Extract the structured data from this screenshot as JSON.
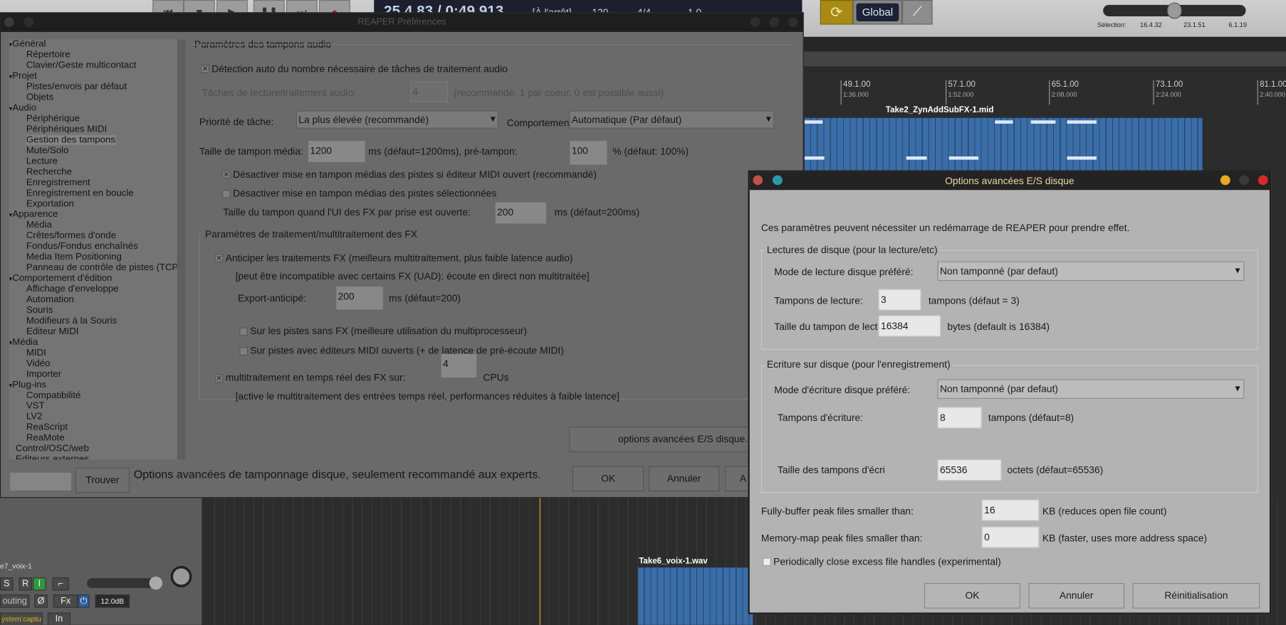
{
  "transport": {
    "buttons": [
      "⏮",
      "■",
      "▶",
      "❚❚",
      "⏭",
      "●"
    ],
    "time": "25.4.83 / 0:49.913",
    "state": "[À l'arrêt]",
    "bpm": "120",
    "sig": "4/4",
    "rate": "1.0"
  },
  "toolbar": {
    "global_label": "Global",
    "selection_label": "Sélection:",
    "sel_start": "16.4.32",
    "sel_end": "23.1.51",
    "sel_len": "6.1.19"
  },
  "ruler": [
    {
      "bar": "49.1.00",
      "time": "1:36.000"
    },
    {
      "bar": "57.1.00",
      "time": "1:52.000"
    },
    {
      "bar": "65.1.00",
      "time": "2:08.000"
    },
    {
      "bar": "73.1.00",
      "time": "2:24.000"
    },
    {
      "bar": "81.1.00",
      "time": "2:40.000"
    }
  ],
  "items": {
    "midi": "Take2_ZynAddSubFX-1.mid",
    "audio": "Take6_voix-1.wav"
  },
  "track": {
    "name": "e7_voix-1",
    "solo": "S",
    "rec": "R",
    "input": "I",
    "routing": "outing",
    "phase": "Ø",
    "fx": "Fx",
    "gain": "12.0dB",
    "input_src": "ystem:captu",
    "in": "In"
  },
  "prefs": {
    "title": "REAPER Préférences",
    "tree": [
      {
        "l": "Général",
        "lvl": 0
      },
      {
        "l": "Répertoire",
        "lvl": 1
      },
      {
        "l": "Clavier/Geste multicontact",
        "lvl": 1
      },
      {
        "l": "Projet",
        "lvl": 0
      },
      {
        "l": "Pistes/envois par défaut",
        "lvl": 1
      },
      {
        "l": "Objets",
        "lvl": 1
      },
      {
        "l": "Audio",
        "lvl": 0
      },
      {
        "l": "Périphérique",
        "lvl": 1
      },
      {
        "l": "Périphériques MIDI",
        "lvl": 1
      },
      {
        "l": "Gestion des tampons",
        "lvl": 1,
        "selected": true
      },
      {
        "l": "Mute/Solo",
        "lvl": 1
      },
      {
        "l": "Lecture",
        "lvl": 1
      },
      {
        "l": "Recherche",
        "lvl": 1
      },
      {
        "l": "Enregistrement",
        "lvl": 1
      },
      {
        "l": "Enregistrement en boucle",
        "lvl": 1
      },
      {
        "l": "Exportation",
        "lvl": 1
      },
      {
        "l": "Apparence",
        "lvl": 0
      },
      {
        "l": "Média",
        "lvl": 1
      },
      {
        "l": "Crêtes/formes d'onde",
        "lvl": 1
      },
      {
        "l": "Fondus/Fondus enchaînés",
        "lvl": 1
      },
      {
        "l": "Media Item Positioning",
        "lvl": 1
      },
      {
        "l": "Panneau de contrôle de pistes (TCP)",
        "lvl": 1
      },
      {
        "l": "Comportement d'édition",
        "lvl": 0
      },
      {
        "l": "Affichage d'enveloppe",
        "lvl": 1
      },
      {
        "l": "Automation",
        "lvl": 1
      },
      {
        "l": "Souris",
        "lvl": 1
      },
      {
        "l": "Modifieurs à la Souris",
        "lvl": 1
      },
      {
        "l": "Editeur MIDI",
        "lvl": 1
      },
      {
        "l": "Média",
        "lvl": 0
      },
      {
        "l": "MIDI",
        "lvl": 1
      },
      {
        "l": "Vidéo",
        "lvl": 1
      },
      {
        "l": "Importer",
        "lvl": 1
      },
      {
        "l": "Plug-ins",
        "lvl": 0
      },
      {
        "l": "Compatibilité",
        "lvl": 1
      },
      {
        "l": "VST",
        "lvl": 1
      },
      {
        "l": "LV2",
        "lvl": 1
      },
      {
        "l": "ReaScript",
        "lvl": 1
      },
      {
        "l": "ReaMote",
        "lvl": 1
      },
      {
        "l": "Control/OSC/web",
        "lvl": 0,
        "leaf": true
      },
      {
        "l": "Editeurs externes",
        "lvl": 0,
        "leaf": true
      }
    ],
    "section": "Paramètres des tampons audio",
    "auto_detect": "Détection auto du nombre nécessaire de tâches de traitement audio",
    "tasks_label": "Tâches de lecture/traitement audio:",
    "tasks_value": "4",
    "tasks_hint": "(recommandé: 1 par coeur, 0 est possible aussi)",
    "priority_label": "Priorité de tâche:",
    "priority_value": "La plus élevée (recommandé)",
    "behavior_label": "Comportemen",
    "behavior_value": "Automatique (Par défaut)",
    "media_buf_label": "Taille de tampon média:",
    "media_buf_value": "1200",
    "media_buf_hint": "ms (défaut=1200ms), pré-tampon:",
    "prebuf_value": "100",
    "prebuf_hint": "% (défaut: 100%)",
    "disable_midi": "Désactiver mise en tampon médias des pistes si éditeur MIDI ouvert (recommandé)",
    "disable_sel": "Désactiver mise en tampon médias des pistes sélectionnées",
    "fxui_label": "Taille du tampon quand l'UI des FX par prise est ouverte:",
    "fxui_value": "200",
    "fxui_hint": "ms (défaut=200ms)",
    "fx_section": "Paramètres de traitement/multitraitement des FX",
    "anticipate": "Anticiper les traitements FX (meilleurs multitraitement, plus faible latence audio)",
    "uad_note": "[peut être incompatible avec certains FX (UAD): écoute en direct non multitraitée]",
    "export_label": "Export-anticipé:",
    "export_value": "200",
    "export_hint": "ms (défaut=200)",
    "no_fx": "Sur les pistes sans FX (meilleure utilisation du multiprocesseur)",
    "midi_editors": "Sur pistes avec éditeurs MIDI ouverts (+ de latence de pré-écoute MIDI)",
    "rt_label": "multitraitement en temps réel des FX sur:",
    "rt_value": "4",
    "rt_unit": "CPUs",
    "rt_note": "[active le multitraitement des entrées temps réel, performances réduites à faible latence]",
    "adv_button": "options avancées E/S disque...",
    "search_placeholder": "",
    "find_button": "Trouver",
    "status": "Options avancées de tamponnage disque, seulement recommandé aux experts.",
    "ok": "OK",
    "cancel": "Annuler",
    "apply": "A"
  },
  "opts": {
    "title": "Options avancées E/S disque",
    "note": "Ces paramètres peuvent nécessiter un redémarrage de REAPER pour prendre effet.",
    "read_group": "Lectures de disque (pour la lecture/etc)",
    "read_mode_label": "Mode de lecture disque préféré:",
    "read_mode_value": "Non tamponné (par defaut)",
    "read_bufs_label": "Tampons de lecture:",
    "read_bufs_value": "3",
    "read_bufs_hint": "tampons (défaut = 3)",
    "read_size_label": "Taille du tampon de lectu",
    "read_size_value": "16384",
    "read_size_hint": "bytes (default is 16384)",
    "write_group": "Ecriture sur disque (pour l'enregistrement)",
    "write_mode_label": "Mode d'écriture disque préféré:",
    "write_mode_value": "Non tamponné (par defaut)",
    "write_bufs_label": "Tampons d'écriture:",
    "write_bufs_value": "8",
    "write_bufs_hint": "tampons (défaut=8)",
    "write_size_label": "Taille des tampons d'écri",
    "write_size_value": "65536",
    "write_size_hint": "octets (défaut=65536)",
    "fully_label": "Fully-buffer peak files smaller than:",
    "fully_value": "16",
    "fully_hint": "KB (reduces open file count)",
    "mmap_label": "Memory-map peak files smaller than:",
    "mmap_value": "0",
    "mmap_hint": "KB (faster, uses more address space)",
    "close_handles": "Periodically close excess file handles (experimental)",
    "ok": "OK",
    "cancel": "Annuler",
    "reset": "Réinitialisation"
  }
}
